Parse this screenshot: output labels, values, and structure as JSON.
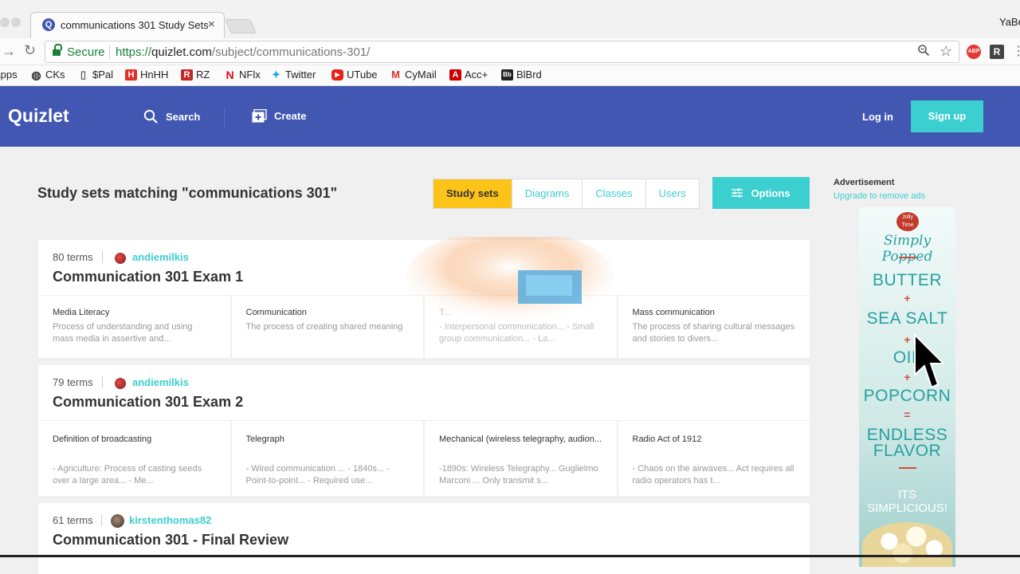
{
  "browser": {
    "tab_title": "communications 301 Study Sets",
    "tab_close": "×",
    "profile": "YaBe",
    "secure_label": "Secure",
    "url_proto": "https://",
    "url_host": "quizlet.com",
    "url_path": "/subject/communications-301/",
    "ext_abp": "ABP",
    "ext_r": "R",
    "bookmarks": [
      {
        "label": "Apps",
        "icon": "apps-icon"
      },
      {
        "label": "CKs",
        "icon": "ck-icon"
      },
      {
        "label": "$Pal",
        "icon": "page-icon"
      },
      {
        "label": "HnHH",
        "icon": "hnhh-icon"
      },
      {
        "label": "RZ",
        "icon": "rz-icon"
      },
      {
        "label": "NFlx",
        "icon": "netflix-icon"
      },
      {
        "label": "Twitter",
        "icon": "twitter-icon"
      },
      {
        "label": "UTube",
        "icon": "youtube-icon"
      },
      {
        "label": "CyMail",
        "icon": "gmail-icon"
      },
      {
        "label": "Acc+",
        "icon": "acc-icon"
      },
      {
        "label": "BlBrd",
        "icon": "blackboard-icon"
      }
    ]
  },
  "header": {
    "logo": "Quizlet",
    "search_label": "Search",
    "create_label": "Create",
    "login_label": "Log in",
    "signup_label": "Sign up",
    "brand_color": "#4257b2",
    "accent_color": "#3ccfcf"
  },
  "main": {
    "title": "Study sets matching \"communications 301\"",
    "filters": [
      {
        "label": "Study sets",
        "active": true
      },
      {
        "label": "Diagrams",
        "active": false
      },
      {
        "label": "Classes",
        "active": false
      },
      {
        "label": "Users",
        "active": false
      }
    ],
    "options_label": "Options",
    "results": [
      {
        "term_count": "80 terms",
        "author": "andiemilkis",
        "title": "Communication 301 Exam 1",
        "terms": [
          {
            "word": "Media Literacy",
            "def": "Process of understanding and using mass media in assertive and..."
          },
          {
            "word": "Communication",
            "def": "The process of creating shared meaning"
          },
          {
            "word": "T...",
            "def": "- Interpersonal communication... - Small group communication... - La..."
          },
          {
            "word": "Mass communication",
            "def": "The process of sharing cultural messages and stories to divers..."
          }
        ]
      },
      {
        "term_count": "79 terms",
        "author": "andiemilkis",
        "title": "Communication 301 Exam 2",
        "terms": [
          {
            "word": "Definition of broadcasting",
            "def": "- Agriculture: Process of casting seeds over a large area... - Me..."
          },
          {
            "word": "Telegraph",
            "def": "- Wired communication ... - 1840s... - Point-to-point... - Required use..."
          },
          {
            "word": "Mechanical (wireless telegraphy, audion...",
            "def": "-1890s: Wireless Telegraphy... Guglielmo Marconi ... Only transmit s..."
          },
          {
            "word": "Radio Act of 1912",
            "def": "- Chaos on the airwaves... Act requires all radio operators has t..."
          }
        ]
      },
      {
        "term_count": "61 terms",
        "author": "kirstenthomas82",
        "title": "Communication 301 - Final Review",
        "terms": []
      }
    ]
  },
  "ad": {
    "label": "Advertisement",
    "remove_link": "Upgrade to remove ads",
    "brand": "Jolly Time",
    "slogan": "Simply Popped",
    "words": [
      "BUTTER",
      "SEA SALT",
      "OIL",
      "POPCORN",
      "ENDLESS",
      "FLAVOR"
    ],
    "plus": "+",
    "equals": "=",
    "tagline_1": "ITS",
    "tagline_2": "SIMPLICIOUS!"
  }
}
